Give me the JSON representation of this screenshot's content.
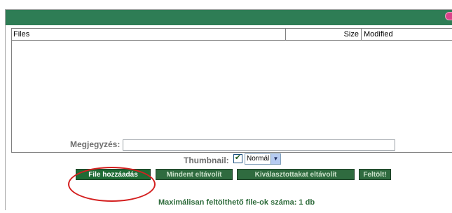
{
  "titlebar": {
    "accent_color": "#2e7d55",
    "logo": "brand-mark"
  },
  "filelist": {
    "columns": [
      "Files",
      "Size",
      "Modified"
    ],
    "rows": []
  },
  "note": {
    "label": "Megjegyzés:",
    "value": ""
  },
  "thumbnail": {
    "label": "Thumbnail:",
    "checked": true,
    "selected": "Normál"
  },
  "buttons": {
    "add": "File hozzáadás",
    "remove_all": "Mindent eltávolít",
    "remove_selected": "Kiválasztottakat eltávolít",
    "upload": "Feltölt!"
  },
  "max_info": "Maximálisan feltölthető file-ok száma: 1 db",
  "annotation": {
    "color": "#d42020",
    "shape": "ellipse"
  }
}
